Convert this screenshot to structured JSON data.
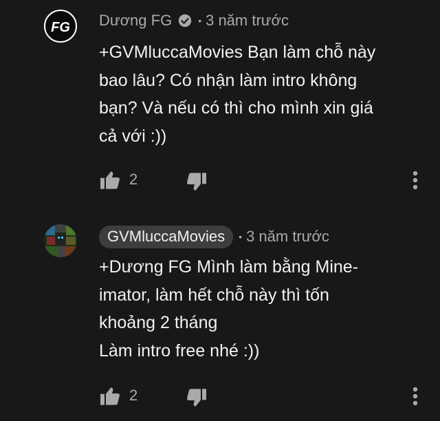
{
  "comments": [
    {
      "author": "Dương FG",
      "verified_icon": "check-circle-icon",
      "separator": "•",
      "time": "3 năm trước",
      "lines": [
        "+GVMluccaMovies Bạn làm chỗ này",
        "bao lâu? Có nhận làm intro không",
        "bạn? Và nếu có thì cho mình xin giá",
        "cả với :))"
      ],
      "likes": "2",
      "avatar_text": "FG"
    },
    {
      "author": "GVMluccaMovies",
      "separator": "•",
      "time": "3 năm trước",
      "lines": [
        "+Dương FG Mình làm bằng Mine-",
        "imator, làm hết chỗ này thì tốn",
        "khoảng 2 tháng",
        "Làm intro free nhé :))"
      ],
      "likes": "2"
    }
  ],
  "colors": {
    "background": "#181818",
    "text": "#f1f1f1",
    "secondary": "#aaaaaa",
    "author_chip": "#3d3d3d"
  },
  "icons": {
    "like": "thumbs-up-icon",
    "dislike": "thumbs-down-icon",
    "more": "more-vertical-icon"
  }
}
